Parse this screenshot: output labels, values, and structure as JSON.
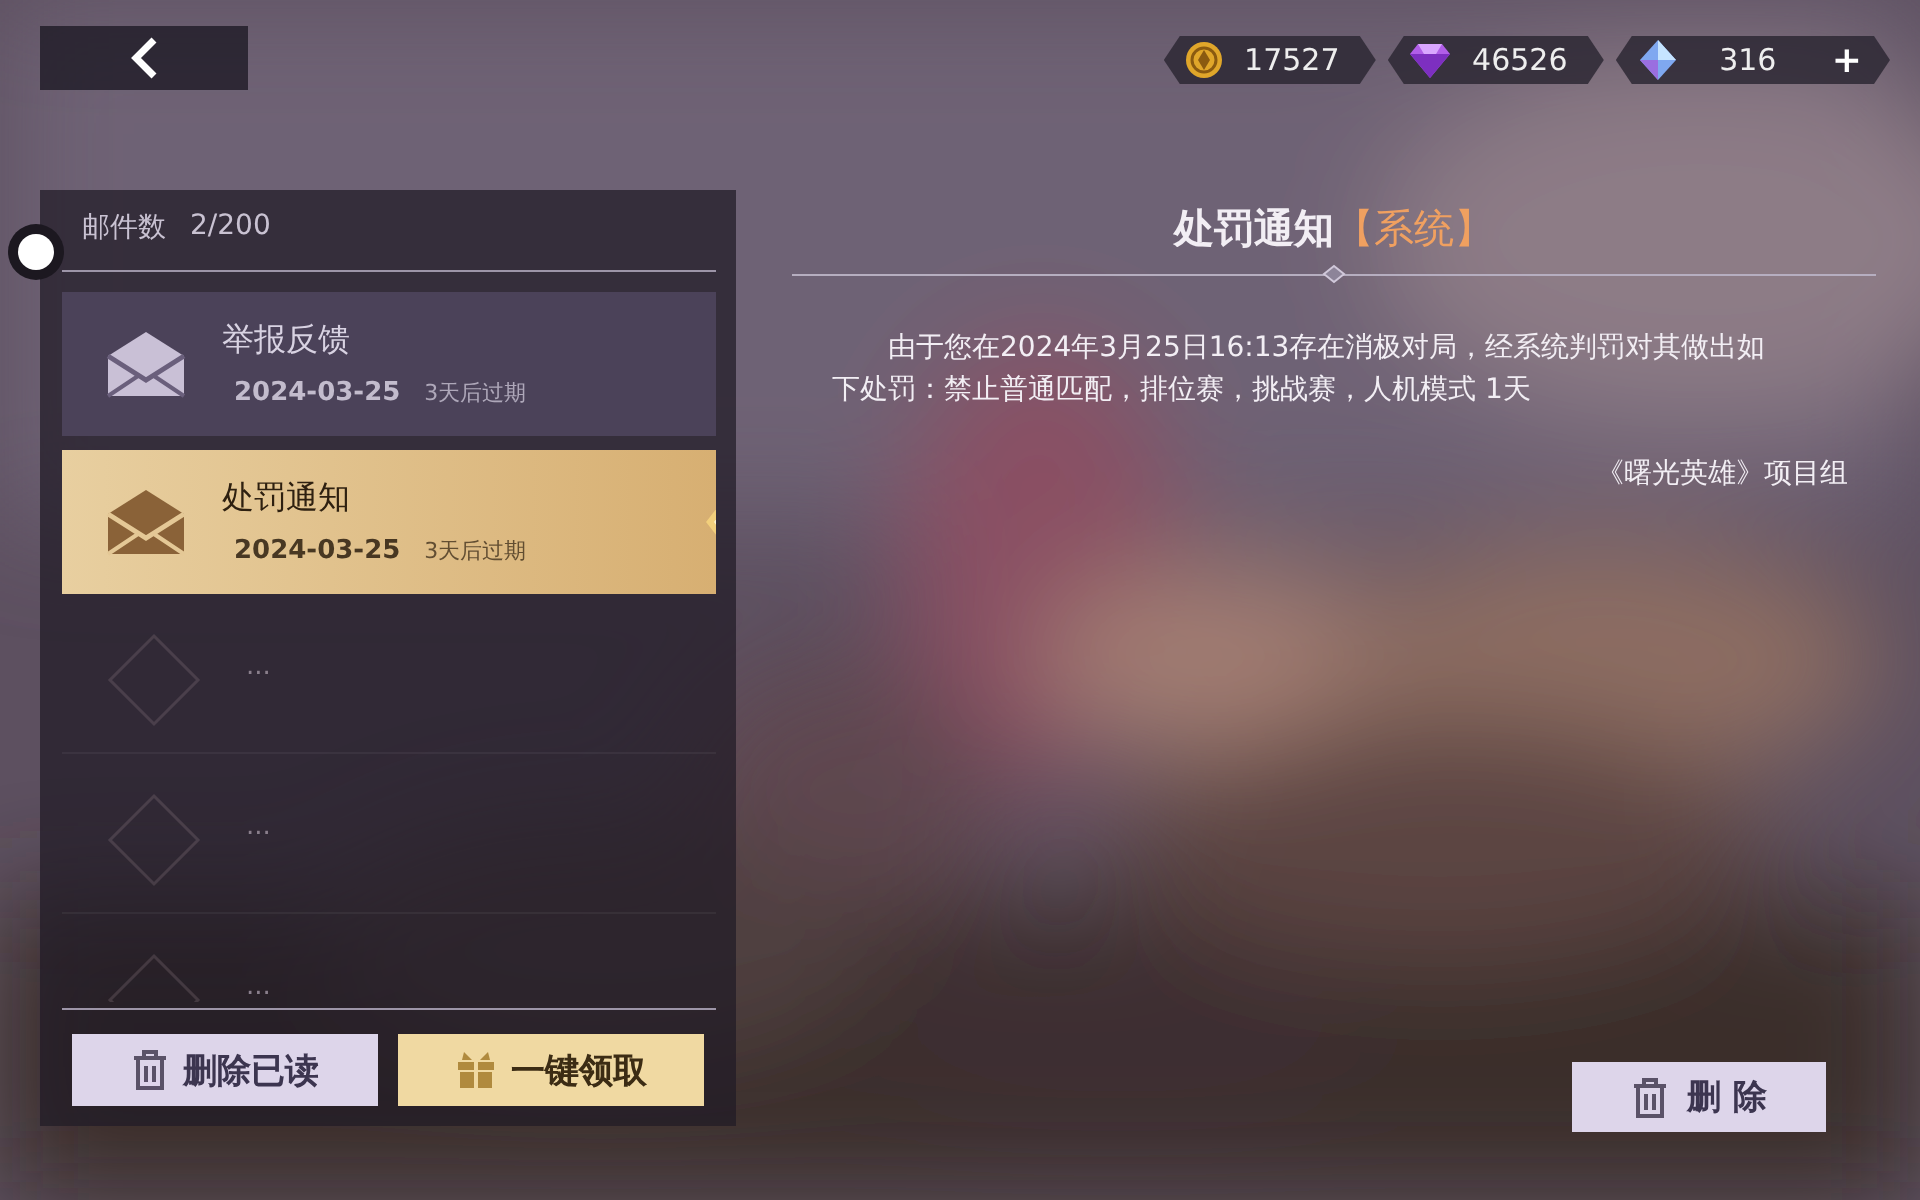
{
  "currencies": [
    {
      "kind": "coin",
      "amount": "17527"
    },
    {
      "kind": "gem",
      "amount": "46526"
    },
    {
      "kind": "crystal",
      "amount": "316",
      "add": "+"
    }
  ],
  "mail_panel": {
    "count_label": "邮件数",
    "count": "2/200",
    "items": [
      {
        "kind": "mail",
        "title": "举报反馈",
        "date": "2024-03-25",
        "expiry": "3天后过期",
        "selected": false
      },
      {
        "kind": "mail",
        "title": "处罚通知",
        "date": "2024-03-25",
        "expiry": "3天后过期",
        "selected": true
      },
      {
        "kind": "empty",
        "text": "..."
      },
      {
        "kind": "empty",
        "text": "..."
      },
      {
        "kind": "empty",
        "text": "..."
      }
    ],
    "buttons": [
      {
        "kind": "delete",
        "label": "删除已读"
      },
      {
        "kind": "claim",
        "label": "一键领取"
      }
    ]
  },
  "message": {
    "title": "处罚通知",
    "tag": "【系统】",
    "body": "由于您在2024年3月25日16:13存在消极对局，经系统判罚对其做出如下处罚：禁止普通匹配，排位赛，挑战赛，人机模式 1天",
    "signature": "《曙光英雄》项目组",
    "delete_button": "删 除"
  }
}
